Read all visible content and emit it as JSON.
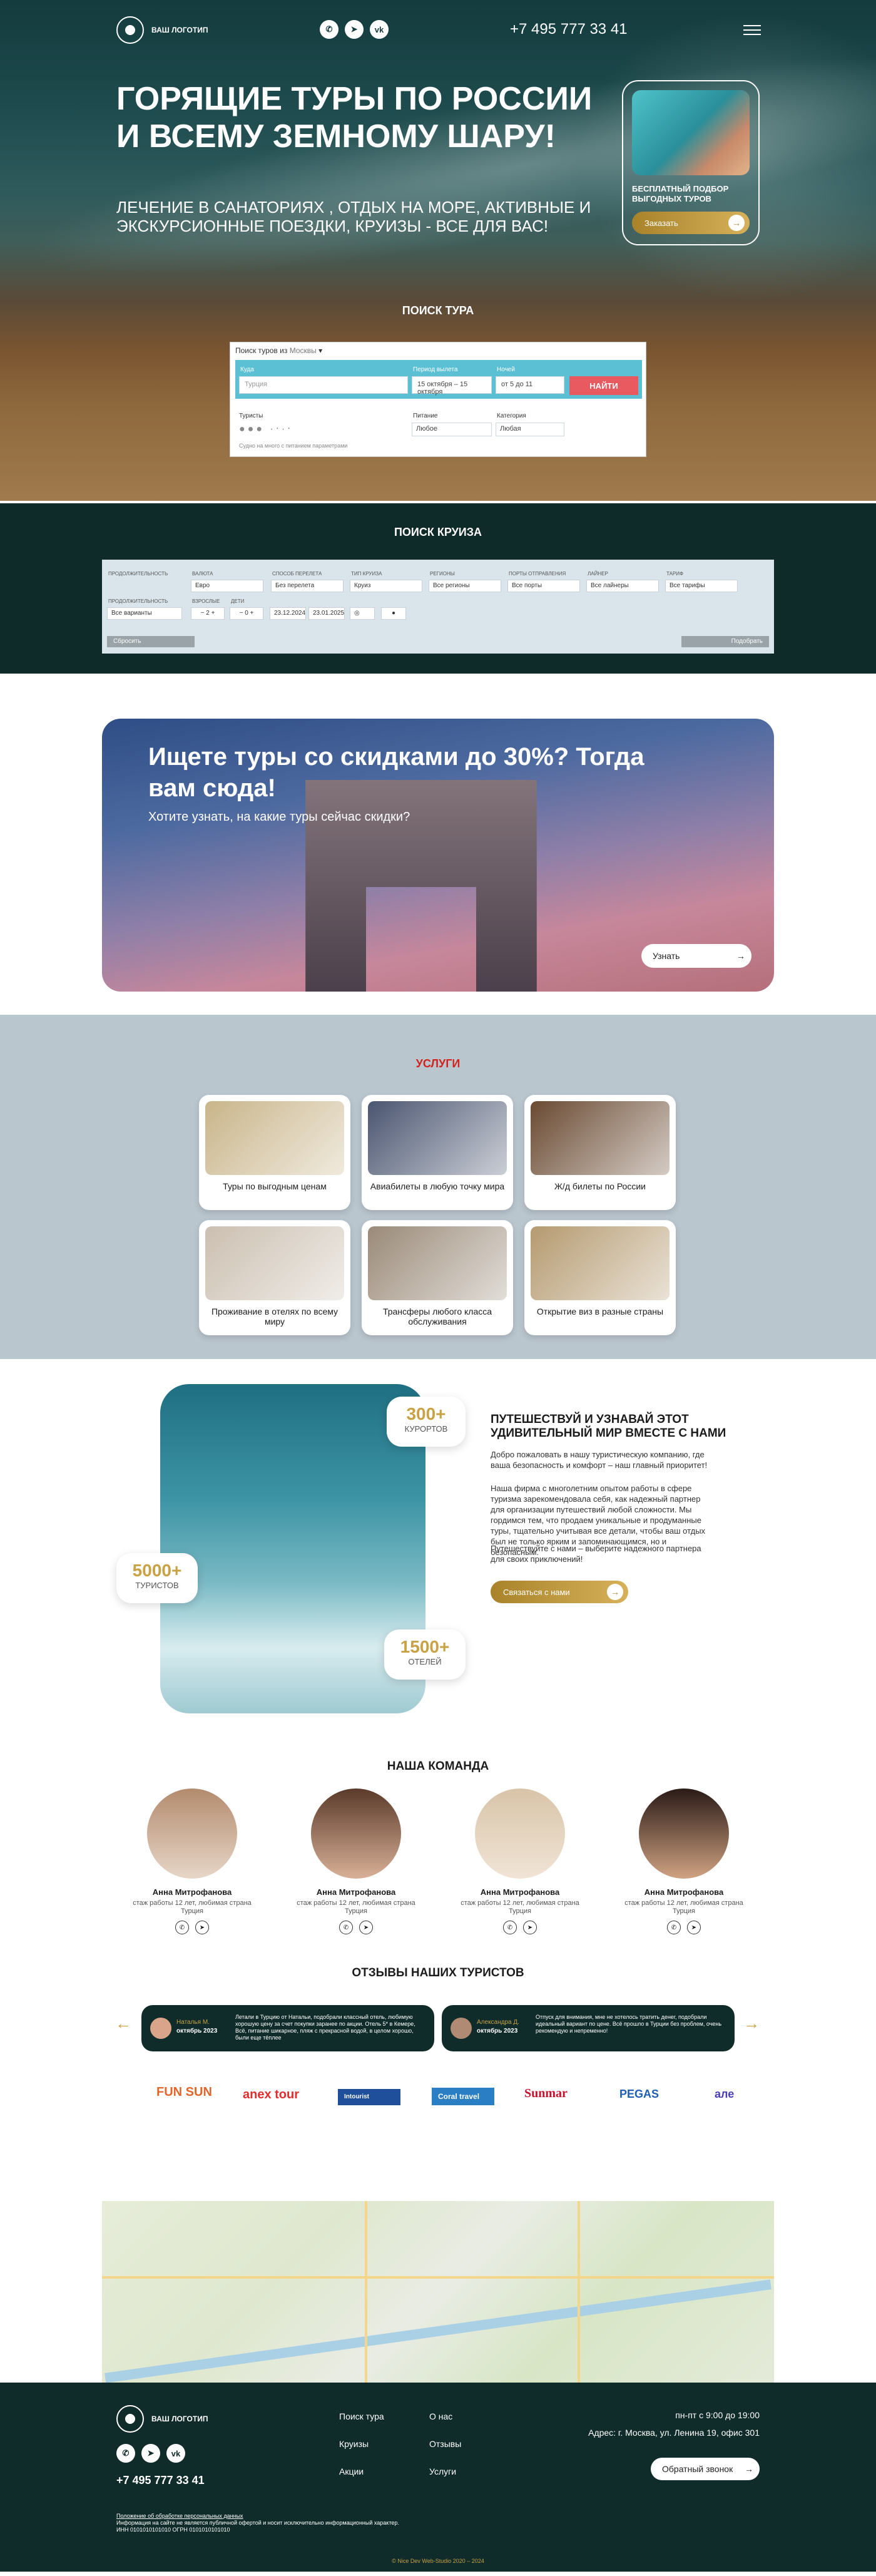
{
  "header": {
    "logo": "ВАШ ЛОГОТИП",
    "phone": "+7 495 777 33 41",
    "social": [
      "whatsapp-icon",
      "telegram-icon",
      "vk-icon"
    ]
  },
  "hero": {
    "title": "ГОРЯЩИЕ ТУРЫ ПО РОССИИ И ВСЕМУ ЗЕМНОМУ ШАРУ!",
    "subtitle": "ЛЕЧЕНИЕ В САНАТОРИЯХ , ОТДЫХ НА МОРЕ, АКТИВНЫЕ И ЭКСКУРСИОННЫЕ ПОЕЗДКИ, КРУИЗЫ - ВСЕ ДЛЯ ВАС!",
    "promo_title": "БЕСПЛАТНЫЙ ПОДБОР ВЫГОДНЫХ ТУРОВ",
    "promo_button": "Заказать"
  },
  "tour_search": {
    "title": "ПОИСК ТУРА",
    "from_label": "Поиск туров из",
    "from_city": "Москвы",
    "where_label": "Куда",
    "where_placeholder": "Турция",
    "period_label": "Период вылета",
    "period_value": "15 октября – 15 октября",
    "nights_label": "Ночей",
    "nights_value": "от 5 до 11",
    "find_button": "НАЙТИ",
    "tourists_label": "Туристы",
    "food_label": "Питание",
    "food_value": "Любое",
    "category_label": "Категория",
    "category_value": "Любая",
    "agree_text": "Судно на много с питанием параметрами"
  },
  "cruise_search": {
    "title": "ПОИСК КРУИЗА",
    "fields": [
      {
        "label": "ВАЛЮТА",
        "value": "Евро"
      },
      {
        "label": "СПОСОБ ПЕРЕЛЕТА",
        "value": "Без перелета"
      },
      {
        "label": "ТИП КРУИЗА",
        "value": "Круиз"
      },
      {
        "label": "РЕГИОНЫ",
        "value": "Все регионы"
      },
      {
        "label": "ПОРТЫ ОТПРАВЛЕНИЯ",
        "value": "Все порты"
      },
      {
        "label": "ЛАЙНЕР",
        "value": "Все лайнеры"
      },
      {
        "label": "ТАРИФ",
        "value": "Все тарифы"
      }
    ],
    "duration_label": "ПРОДОЛЖИТЕЛЬНОСТЬ",
    "duration_value": "Все варианты",
    "adults_label": "ВЗРОСЛЫЕ",
    "adults_value": "2",
    "children_label": "ДЕТИ",
    "children_value": "0",
    "date_from": "23.12.2024",
    "date_to": "23.01.2025",
    "reset_button": "Сбросить",
    "pick_button": "Подобрать"
  },
  "banner": {
    "title": "Ищете туры со скидками до 30%? Тогда вам сюда!",
    "subtitle": "Хотите узнать, на какие туры сейчас скидки?",
    "button": "Узнать"
  },
  "services": {
    "title": "УСЛУГИ",
    "items": [
      {
        "label": "Туры по выгодным ценам",
        "color": "#c9b58a"
      },
      {
        "label": "Авиабилеты в любую точку мира",
        "color": "#4a5570"
      },
      {
        "label": "Ж/д билеты по России",
        "color": "#6a4a32"
      },
      {
        "label": "Проживание в отелях по всему миру",
        "color": "#cbbfb0"
      },
      {
        "label": "Трансферы любого класса обслуживания",
        "color": "#9a8a78"
      },
      {
        "label": "Открытие виз в разные страны",
        "color": "#b59a70"
      }
    ]
  },
  "about": {
    "stat1_num": "300+",
    "stat1_label": "КУРОРТОВ",
    "stat2_num": "5000+",
    "stat2_label": "ТУРИСТОВ",
    "stat3_num": "1500+",
    "stat3_label": "ОТЕЛЕЙ",
    "title": "ПУТЕШЕСТВУЙ И УЗНАВАЙ ЭТОТ УДИВИТЕЛЬНЫЙ МИР ВМЕСТЕ С НАМИ",
    "p1": "Добро пожаловать в нашу туристическую компанию, где ваша безопасность и комфорт – наш главный приоритет!",
    "p2": "Наша фирма с многолетним опытом работы в сфере туризма зарекомендовала себя, как надежный партнер для организации путешествий любой сложности. Мы гордимся тем, что продаем уникальные и продуманные туры, тщательно учитывая все детали, чтобы ваш отдых был не только ярким и запоминающимся, но и безопасным.",
    "p3": "Путешествуйте с нами – выберите надежного партнера для своих приключений!",
    "button": "Связаться с нами"
  },
  "team": {
    "title": "НАША КОМАНДА",
    "members": [
      {
        "name": "Анна Митрофанова",
        "desc": "стаж работы 12 лет, любимая страна Турция"
      },
      {
        "name": "Анна Митрофанова",
        "desc": "стаж работы 12 лет, любимая страна Турция"
      },
      {
        "name": "Анна Митрофанова",
        "desc": "стаж работы 12 лет, любимая страна Турция"
      },
      {
        "name": "Анна Митрофанова",
        "desc": "стаж работы 12 лет, любимая страна Турция"
      }
    ]
  },
  "reviews": {
    "title": "ОТЗЫВЫ НАШИХ ТУРИСТОВ",
    "items": [
      {
        "name": "Наталья М.",
        "date": "октябрь 2023",
        "text": "Летали в Турцию от Натальи, подобрали классный отель, любимую хорошую цену за счет покупки заранее по акции. Отель 5* в Кемере, Всё, питание шикарное, пляж с прекрасной водой, в целом хорошо, были еще тёплее"
      },
      {
        "name": "Александра Д.",
        "date": "октябрь 2023",
        "text": "Отпуск для внимания, мне не хотелось тратить денег, подобрали идеальный вариант по цене. Всё прошло в Турции без проблем, очень рекомендую и непременно!"
      }
    ]
  },
  "partners": [
    "FUN SUN",
    "anex tour",
    "Intourist",
    "Coral travel",
    "Sunmar",
    "PEGAS",
    "але"
  ],
  "footer": {
    "logo": "ВАШ ЛОГОТИП",
    "phone": "+7 495 777 33 41",
    "links1": [
      "Поиск тура",
      "Круизы",
      "Акции"
    ],
    "links2": [
      "О нас",
      "Отзывы",
      "Услуги"
    ],
    "hours": "пн-пт с 9:00 до 19:00",
    "address": "Адрес: г. Москва, ул. Ленина 19, офис 301",
    "callback": "Обратный звонок",
    "policy": "Положение об обработке персональных данных",
    "disclaimer": "Информация на сайте не является публичной офертой и носит исключительно информационный характер.",
    "inn": "ИНН 0101010101010 ОГРН 0101010101010",
    "copyright": "© Nice Dev Web-Studio 2020 – 2024"
  }
}
